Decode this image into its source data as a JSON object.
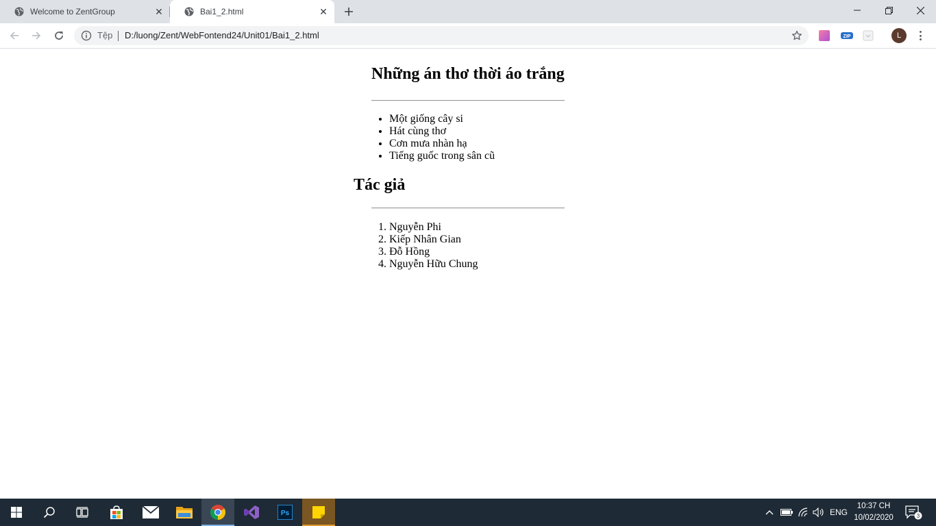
{
  "browser": {
    "tabs": [
      {
        "title": "Welcome to ZentGroup",
        "icon": "globe-icon",
        "active": false
      },
      {
        "title": "Bai1_2.html",
        "icon": "globe-icon",
        "active": true
      }
    ],
    "address": {
      "security_label": "Tệp",
      "url": "D:/luong/Zent/WebFontend24/Unit01/Bai1_2.html"
    },
    "profile_initial": "L",
    "extension_zip_label": "ZIP"
  },
  "page": {
    "heading1": "Những án thơ thời áo trắng",
    "poems": [
      "Một giống cây si",
      "Hát cùng thơ",
      "Cơn mưa nhàn hạ",
      "Tiếng guốc trong sân cũ"
    ],
    "heading2": "Tác giả",
    "authors": [
      "Nguyễn Phi",
      "Kiếp Nhân Gian",
      "Đỗ Hồng",
      "Nguyễn Hữu Chung"
    ]
  },
  "taskbar": {
    "apps": [
      "windows-start",
      "search",
      "task-view",
      "microsoft-store",
      "mail",
      "file-explorer",
      "chrome",
      "visual-studio",
      "photoshop",
      "sticky-notes"
    ],
    "photoshop_label": "Ps",
    "language": "ENG",
    "time": "10:37 CH",
    "date": "10/02/2020",
    "notification_count": "3"
  },
  "colors": {
    "tabstrip": "#dee1e6",
    "taskbar": "#1e2a35",
    "chrome_red": "#db4437",
    "chrome_yellow": "#f4c20d",
    "chrome_green": "#0f9d58",
    "chrome_blue": "#4285f4"
  }
}
